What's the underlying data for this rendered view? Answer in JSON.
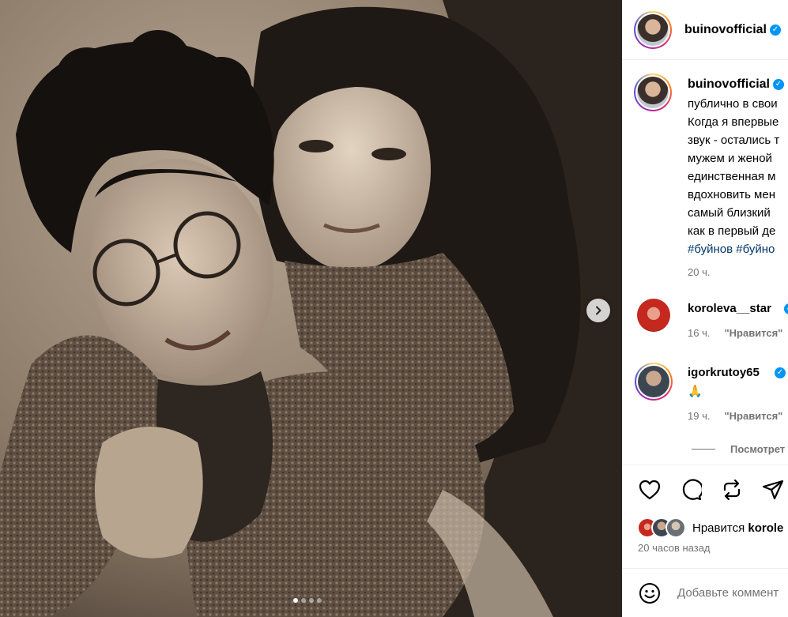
{
  "post": {
    "author": "buinovofficial",
    "caption_lines": [
      "публично в свои",
      "Когда я впервые",
      "звук - остались т",
      "мужем и женой",
      "единственная м",
      "вдохновить мен",
      "самый близкий",
      "как в первый де"
    ],
    "hashtags": "#буйнов #буйно",
    "caption_time": "20 ч.",
    "carousel": {
      "total": 4,
      "current": 1
    }
  },
  "comments": [
    {
      "user": "koroleva__star",
      "text": "",
      "time": "16 ч.",
      "like_label": "\"Нравится\""
    },
    {
      "user": "igorkrutoy65",
      "text": "🙏",
      "time": "19 ч.",
      "like_label": "\"Нравится\""
    }
  ],
  "view_replies": "Посмотрет",
  "likes": {
    "prefix": "Нравится",
    "user": "korole"
  },
  "time_ago": "20 часов назад",
  "comment_input": {
    "placeholder": "Добавьте коммент"
  },
  "icons": {
    "like": "heart-icon",
    "comment": "comment-bubble-icon",
    "repost": "repost-icon",
    "share": "paper-plane-icon",
    "next": "chevron-right-icon",
    "emoji": "smiley-icon",
    "verified": "verified-badge-icon"
  },
  "colors": {
    "verified": "#0095f6",
    "hashtag": "#00376b",
    "muted": "#737373"
  }
}
